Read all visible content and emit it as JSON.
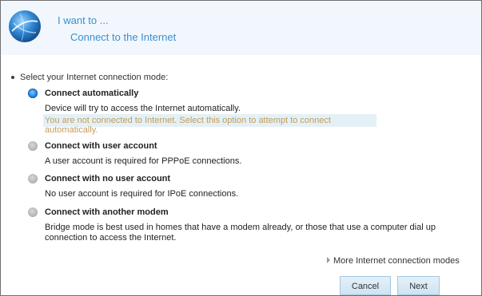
{
  "header": {
    "line1": "I want to ...",
    "line2": "Connect to the Internet"
  },
  "prompt": "Select your Internet connection mode:",
  "options": [
    {
      "title": "Connect automatically",
      "desc": "Device will try to access the Internet automatically.",
      "selected": true,
      "notice": "You are not connected to Internet. Select this option to attempt to connect automatically."
    },
    {
      "title": "Connect with user account",
      "desc": "A user account is required for PPPoE connections.",
      "selected": false
    },
    {
      "title": "Connect with no user account",
      "desc": "No user account is required for IPoE connections.",
      "selected": false
    },
    {
      "title": "Connect with another modem",
      "desc": "Bridge mode is best used in homes that have a modem already, or those that use a computer dial up connection to access the Internet.",
      "selected": false
    }
  ],
  "more_link": "More Internet connection modes",
  "buttons": {
    "cancel": "Cancel",
    "next": "Next"
  },
  "colors": {
    "accent": "#3b8fd0",
    "header_bg": "#f1f7fc",
    "notice_bg": "#e3f1f7",
    "notice_text": "#c49b5a"
  }
}
